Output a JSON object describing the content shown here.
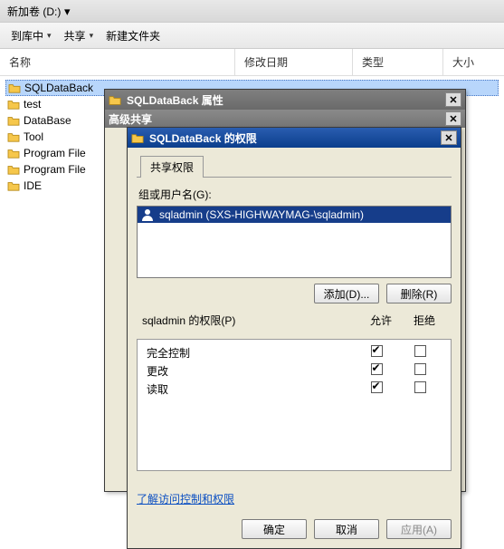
{
  "explorer": {
    "title": "新加卷 (D:)",
    "toolbar": {
      "include": "到库中",
      "share": "共享",
      "newfolder": "新建文件夹"
    },
    "columns": {
      "name": "名称",
      "modified": "修改日期",
      "type": "类型",
      "size": "大小"
    },
    "files": [
      {
        "name": "SQLDataBack",
        "selected": true
      },
      {
        "name": "test"
      },
      {
        "name": "DataBase"
      },
      {
        "name": "Tool"
      },
      {
        "name": "Program File"
      },
      {
        "name": "Program File"
      },
      {
        "name": "IDE"
      }
    ]
  },
  "propsDialog": {
    "title": "SQLDataBack 属性",
    "subtitle": "高级共享"
  },
  "permDialog": {
    "title": "SQLDataBack 的权限",
    "tab": "共享权限",
    "groupLabel": "组或用户名(G):",
    "user": "sqladmin (SXS-HIGHWAYMAG-\\sqladmin)",
    "addBtn": "添加(D)...",
    "removeBtn": "删除(R)",
    "permHeader": "sqladmin 的权限(P)",
    "allow": "允许",
    "deny": "拒绝",
    "perms": [
      {
        "label": "完全控制",
        "allow": true,
        "deny": false
      },
      {
        "label": "更改",
        "allow": true,
        "deny": false
      },
      {
        "label": "读取",
        "allow": true,
        "deny": false
      }
    ],
    "link": "了解访问控制和权限",
    "ok": "确定",
    "cancel": "取消",
    "apply": "应用(A)"
  }
}
